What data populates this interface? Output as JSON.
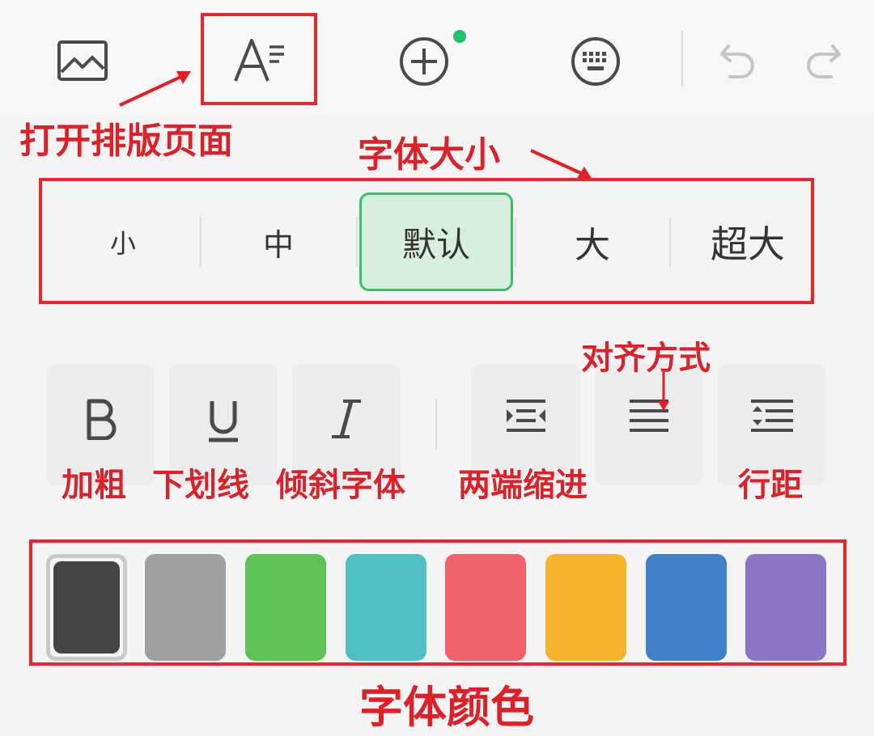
{
  "annotations": {
    "open_layout": "打开排版页面",
    "font_size": "字体大小",
    "alignment": "对齐方式",
    "bold": "加粗",
    "underline": "下划线",
    "italic": "倾斜字体",
    "justify_indent": "两端缩进",
    "line_spacing": "行距",
    "font_color": "字体颜色"
  },
  "toolbar": {
    "icons": [
      "image-icon",
      "text-format-icon",
      "add-icon",
      "keyboard-icon",
      "undo-icon",
      "redo-icon"
    ],
    "add_badge_color": "#1ec46b"
  },
  "font_sizes": {
    "options": [
      "小",
      "中",
      "默认",
      "大",
      "超大"
    ],
    "selected": "默认"
  },
  "format_buttons": [
    "bold-icon",
    "underline-icon",
    "italic-icon",
    "indent-icon",
    "align-justify-icon",
    "line-spacing-icon"
  ],
  "colors": {
    "swatches": [
      "#444444",
      "#a0a0a0",
      "#5cc452",
      "#4fc1c4",
      "#f2626a",
      "#f5b22d",
      "#3f82c9",
      "#8d74c6"
    ],
    "selected": "#444444"
  }
}
